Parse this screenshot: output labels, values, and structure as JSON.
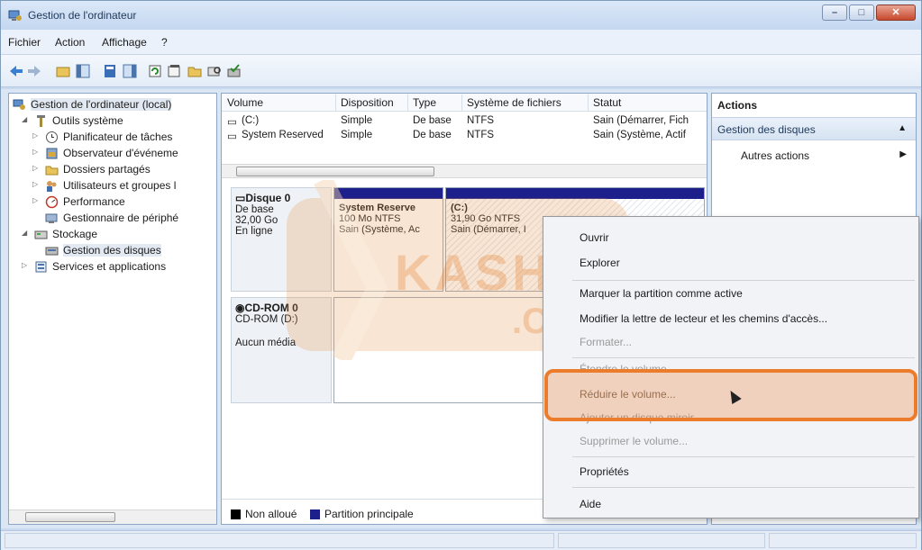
{
  "window": {
    "title": "Gestion de l'ordinateur"
  },
  "menu": {
    "items": [
      "Fichier",
      "Action",
      "Affichage",
      "?"
    ]
  },
  "tree": {
    "items": [
      {
        "label": "Gestion de l'ordinateur (local)",
        "icon": "computer-management-icon"
      },
      {
        "label": "Outils système",
        "icon": "tools-icon"
      },
      {
        "label": "Planificateur de tâches",
        "icon": "clock-icon"
      },
      {
        "label": "Observateur d'événeme",
        "icon": "event-viewer-icon"
      },
      {
        "label": "Dossiers partagés",
        "icon": "shared-folder-icon"
      },
      {
        "label": "Utilisateurs et groupes l",
        "icon": "users-icon"
      },
      {
        "label": "Performance",
        "icon": "performance-icon"
      },
      {
        "label": "Gestionnaire de périphé",
        "icon": "device-manager-icon"
      },
      {
        "label": "Stockage",
        "icon": "storage-icon"
      },
      {
        "label": "Gestion des disques",
        "icon": "disk-management-icon"
      },
      {
        "label": "Services et applications",
        "icon": "services-icon"
      }
    ]
  },
  "volumes": {
    "headers": [
      "Volume",
      "Disposition",
      "Type",
      "Système de fichiers",
      "Statut"
    ],
    "rows": [
      [
        "(C:)",
        "Simple",
        "De base",
        "NTFS",
        "Sain (Démarrer, Fich"
      ],
      [
        "System Reserved",
        "Simple",
        "De base",
        "NTFS",
        "Sain (Système, Actif"
      ]
    ]
  },
  "disks": {
    "disk0": {
      "name": "Disque 0",
      "type": "De base",
      "size": "32,00 Go",
      "status": "En ligne"
    },
    "part_sys": {
      "name": "System Reserve",
      "size": "100 Mo NTFS",
      "status": "Sain (Système, Ac"
    },
    "part_c": {
      "name": "(C:)",
      "size": "31,90 Go NTFS",
      "status": "Sain (Démarrer, I"
    },
    "cdrom": {
      "name": "CD-ROM 0",
      "drive": "CD-ROM (D:)",
      "media": "Aucun média"
    }
  },
  "legend": {
    "unallocated": "Non alloué",
    "primary": "Partition principale",
    "unallocated_color": "#000000",
    "primary_color": "#1d1f8a"
  },
  "actions": {
    "title": "Actions",
    "section": "Gestion des disques",
    "more": "Autres actions"
  },
  "context_menu": {
    "items": [
      {
        "label": "Ouvrir",
        "disabled": false
      },
      {
        "label": "Explorer",
        "disabled": false
      },
      {
        "label": "Marquer la partition comme active",
        "disabled": false
      },
      {
        "label": "Modifier la lettre de lecteur et les chemins d'accès...",
        "disabled": false
      },
      {
        "label": "Formater...",
        "disabled": true
      },
      {
        "label": "Étendre le volume...",
        "disabled": true
      },
      {
        "label": "Réduire le volume...",
        "disabled": false
      },
      {
        "label": "Ajouter un disque miroir...",
        "disabled": true
      },
      {
        "label": "Supprimer le volume...",
        "disabled": true
      },
      {
        "label": "Propriétés",
        "disabled": false
      },
      {
        "label": "Aide",
        "disabled": false
      }
    ]
  },
  "watermark": {
    "text": "KASHOUN",
    "sub": ".COM"
  },
  "colors": {
    "accent": "#ec7b2c",
    "partition_bar": "#1d1f8a"
  }
}
